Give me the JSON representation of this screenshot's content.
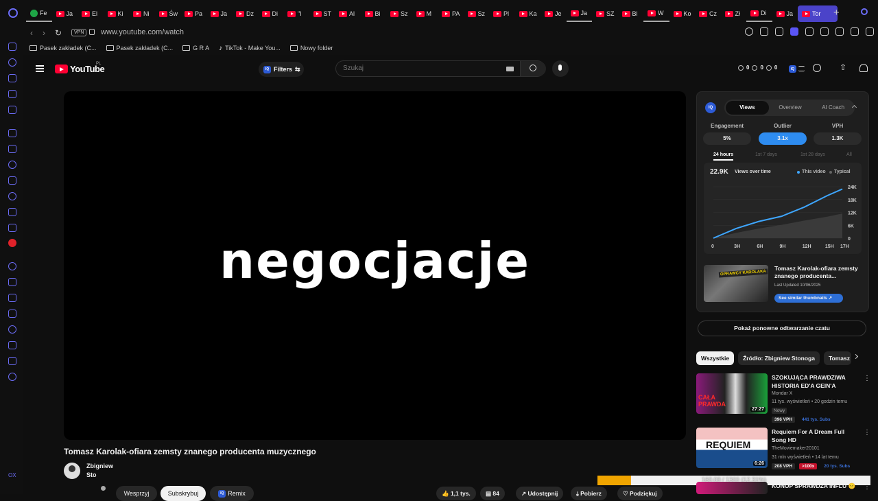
{
  "browser": {
    "tabs": [
      {
        "label": "Fe",
        "icon": "green"
      },
      {
        "label": "Ja",
        "icon": "yt"
      },
      {
        "label": "El",
        "icon": "yt"
      },
      {
        "label": "Ki",
        "icon": "yt"
      },
      {
        "label": "Ni",
        "icon": "yt"
      },
      {
        "label": "Św",
        "icon": "yt"
      },
      {
        "label": "Pa",
        "icon": "yt"
      },
      {
        "label": "Ja",
        "icon": "yt"
      },
      {
        "label": "Dz",
        "icon": "yt"
      },
      {
        "label": "Di",
        "icon": "yt"
      },
      {
        "label": "\"I",
        "icon": "yt"
      },
      {
        "label": "ST",
        "icon": "yt"
      },
      {
        "label": "Al",
        "icon": "yt"
      },
      {
        "label": "Bi",
        "icon": "yt"
      },
      {
        "label": "Sz",
        "icon": "yt"
      },
      {
        "label": "M",
        "icon": "yt"
      },
      {
        "label": "PA",
        "icon": "yt"
      },
      {
        "label": "Sz",
        "icon": "yt"
      },
      {
        "label": "Pl",
        "icon": "yt"
      },
      {
        "label": "Ka",
        "icon": "yt"
      },
      {
        "label": "Je",
        "icon": "yt"
      },
      {
        "label": "Ja",
        "icon": "yt"
      },
      {
        "label": "SZ",
        "icon": "yt"
      },
      {
        "label": "Bl",
        "icon": "yt"
      },
      {
        "label": "W",
        "icon": "yt"
      },
      {
        "label": "Ko",
        "icon": "yt"
      },
      {
        "label": "Cz",
        "icon": "yt"
      },
      {
        "label": "Zł",
        "icon": "yt"
      },
      {
        "label": "Di",
        "icon": "yt"
      },
      {
        "label": "Ja",
        "icon": "yt"
      },
      {
        "label": "Tor",
        "icon": "yt",
        "active": true
      }
    ],
    "url": "www.youtube.com/watch",
    "vpn_label": "VPN",
    "bookmarks": [
      {
        "label": "Pasek zakładek (C...",
        "icon": "folder"
      },
      {
        "label": "Pasek zakładek (C...",
        "icon": "folder"
      },
      {
        "label": "G R A",
        "icon": "folder"
      },
      {
        "label": "TikTok - Make You...",
        "icon": "tiktok"
      },
      {
        "label": "Nowy folder",
        "icon": "folder"
      }
    ],
    "sidebar_bottom": "OX"
  },
  "youtube": {
    "logo_text": "YouTube",
    "country_code": "PL",
    "filters_label": "Filters",
    "iq_label": "IQ",
    "search_placeholder": "Szukaj",
    "header_stats": [
      "0",
      "0",
      "0"
    ],
    "video": {
      "overlay_text": "negocjacje",
      "title": "Tomasz Karolak-ofiara zemsty znanego producenta muzycznego",
      "owner_name": "Zbigniew Sto",
      "buttons": {
        "wesprzyj": "Wesprzyj",
        "subskrybuj": "Subskrybuj",
        "remix": "Remix",
        "likes": "1,1 tys.",
        "comments": "84",
        "share": "Udostępnij",
        "download": "Pobierz",
        "thanks": "Podziękuj"
      },
      "progress_text": "160.00 / 1300 (12.31%)",
      "progress_fraction": 0.1231
    },
    "panel": {
      "tabs": [
        "Views",
        "Overview",
        "AI Coach"
      ],
      "metrics": [
        {
          "label": "Engagement",
          "value": "5%"
        },
        {
          "label": "Outlier",
          "value": "3.1x",
          "highlight": true
        },
        {
          "label": "VPH",
          "value": "1.3K"
        }
      ],
      "ranges": [
        "24 hours",
        "1st 7 days",
        "1st 28 days",
        "All"
      ],
      "thumb_title": "Tomasz Karolak-ofiara zemsty znanego producenta...",
      "thumb_banner": "OPRAWCY KAROLAKA",
      "thumb_date": "Last Updated 10/06/2025",
      "thumb_button": "See similar thumbnails ↗"
    },
    "chart_data": {
      "type": "line",
      "title": "22.9K",
      "subtitle": "Views over time",
      "x": [
        "0",
        "3H",
        "6H",
        "9H",
        "12H",
        "15H",
        "17H"
      ],
      "x_numeric": [
        0,
        3,
        6,
        9,
        12,
        15,
        17
      ],
      "series": [
        {
          "name": "This video",
          "color": "#3ea6ff",
          "values": [
            0,
            4500,
            7800,
            10200,
            14500,
            19800,
            22900
          ]
        },
        {
          "name": "Typical",
          "color": "#6b6b6b",
          "values": [
            0,
            2500,
            4500,
            6200,
            8200,
            10000,
            11500
          ]
        }
      ],
      "yticks": [
        "24K",
        "18K",
        "12K",
        "6K",
        "0"
      ],
      "ylim": [
        0,
        24000
      ],
      "legend_position": "top-right"
    },
    "chat_replay": "Pokaż ponowne odtwarzanie czatu",
    "chips": [
      "Wszystkie",
      "Źródło: Zbigniew Stonoga",
      "Tomasz"
    ],
    "recommendations": [
      {
        "title": "SZOKUJĄCA PRAWDZIWA HISTORIA ED'A GEIN'A",
        "channel": "Mondar X",
        "meta": "11 tys. wyświetleń • 20 godzin temu",
        "badge": "Nowy",
        "vph": "396 VPH",
        "extra": "441 tys. Subs",
        "duration": "27:27",
        "thumb_text": "CAŁA PRAWDA"
      },
      {
        "title": "Requiem For A Dream Full Song HD",
        "channel": "TheMoviemaker20101",
        "meta": "31 mln wyświetleń • 14 lat temu",
        "vph": "208 VPH",
        "multiplier": ">100x",
        "extra": "20 tys. Subs",
        "duration": "6:26",
        "thumb_text": "REQUIEM"
      },
      {
        "title": "KONOP SPRAWDZA INFLU 😐"
      }
    ]
  }
}
